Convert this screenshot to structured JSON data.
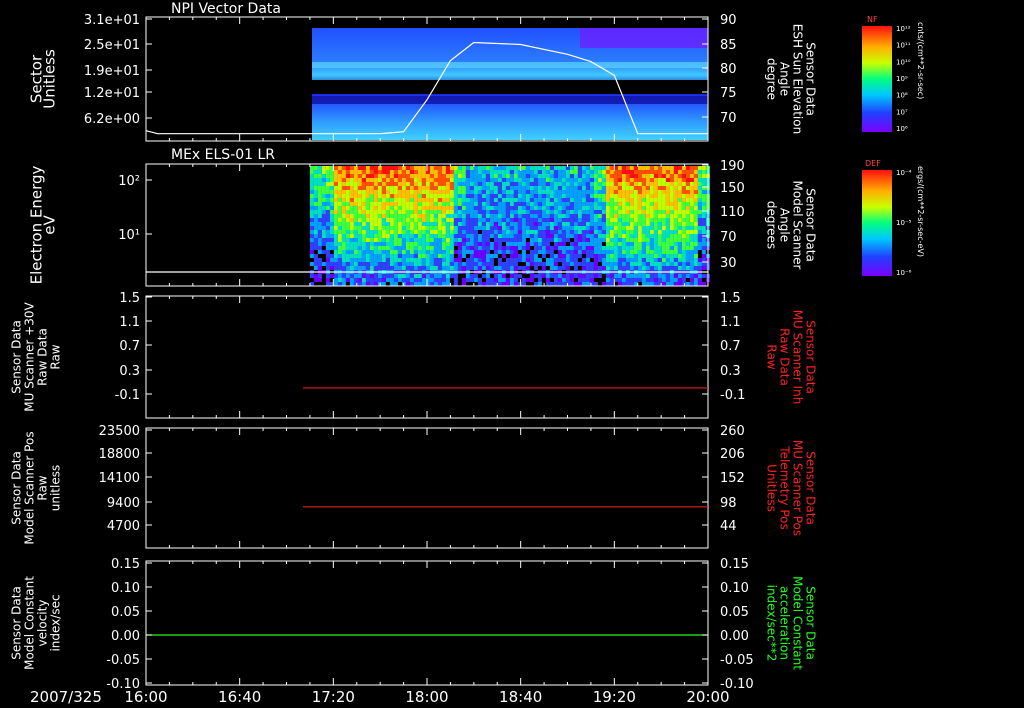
{
  "date_label": "2007/325",
  "x_ticks": [
    "16:00",
    "16:40",
    "17:20",
    "18:00",
    "18:40",
    "19:20",
    "20:00"
  ],
  "panels": [
    {
      "title": "NPI Vector Data",
      "left_label": [
        "Sector",
        "Unitless"
      ],
      "left_ticks": [
        "3.1e+01",
        "2.5e+01",
        "1.9e+01",
        "1.2e+01",
        "6.2e+00"
      ],
      "right_label": [
        "Sensor Data",
        "ESH Sun Elevation",
        "Angle",
        "degree"
      ],
      "right_ticks": [
        "90",
        "85",
        "80",
        "75",
        "70"
      ],
      "right_label_color": "#ffffff"
    },
    {
      "title": "MEx ELS-01 LR",
      "left_label": [
        "Electron Energy",
        "eV"
      ],
      "left_ticks": [
        "10²",
        "10¹"
      ],
      "right_label": [
        "Sensor Data",
        "Model Scanner",
        "Angle",
        "degrees"
      ],
      "right_ticks": [
        "190",
        "150",
        "110",
        "70",
        "30"
      ],
      "right_label_color": "#ffffff"
    },
    {
      "title": "",
      "left_label": [
        "Sensor Data",
        "MU Scanner +30V",
        "Raw Data",
        "Raw"
      ],
      "left_ticks": [
        "1.5",
        "1.1",
        "0.7",
        "0.3",
        "-0.1"
      ],
      "right_label": [
        "Sensor Data",
        "MU Scanner Inh",
        "Raw Data",
        "Raw"
      ],
      "right_ticks": [
        "1.5",
        "1.1",
        "0.7",
        "0.3",
        "-0.1"
      ],
      "right_label_color": "#ff2020"
    },
    {
      "title": "",
      "left_label": [
        "Sensor Data",
        "Model Scanner Pos",
        "Raw",
        "unitless"
      ],
      "left_ticks": [
        "23500",
        "18800",
        "14100",
        "9400",
        "4700"
      ],
      "right_label": [
        "Sensor Data",
        "MU Scanner Pos",
        "Telemetry Pos",
        "Unitless"
      ],
      "right_ticks": [
        "260",
        "206",
        "152",
        "98",
        "44"
      ],
      "right_label_color": "#ff2020"
    },
    {
      "title": "",
      "left_label": [
        "Sensor Data",
        "Model Constant",
        "velocity",
        "index/sec"
      ],
      "left_ticks": [
        "0.15",
        "0.10",
        "0.05",
        "0.00",
        "-0.05",
        "-0.10"
      ],
      "right_label": [
        "Sensor Data",
        "Model Constant",
        "acceleration",
        "index/sec**2"
      ],
      "right_ticks": [
        "0.15",
        "0.10",
        "0.05",
        "0.00",
        "-0.05",
        "-0.10"
      ],
      "right_label_color": "#20ff20"
    }
  ],
  "colorbars": [
    {
      "name": "NF",
      "units": "cnts/(cm**2-sr-sec)",
      "ticks": [
        "10¹²",
        "10¹¹",
        "10¹⁰",
        "10⁹",
        "10⁸",
        "10⁷",
        "10⁶"
      ]
    },
    {
      "name": "DEF",
      "units": "ergs/(cm**2-sr-sec-eV)",
      "ticks": [
        "10⁻⁴",
        "10⁻⁵",
        "10⁻⁶"
      ]
    }
  ],
  "chart_data": [
    {
      "type": "heatmap",
      "title": "NPI Vector Data",
      "xlabel": "",
      "ylabel": "Sector Unitless",
      "x_range": [
        "16:00",
        "20:00"
      ],
      "data_start": "17:10",
      "overlay_line": {
        "name": "ESH Sun Elevation Angle",
        "x": [
          "16:00",
          "16:05",
          "17:40",
          "17:50",
          "18:00",
          "18:10",
          "18:20",
          "18:40",
          "19:00",
          "19:10",
          "19:20",
          "19:30",
          "20:00"
        ],
        "y": [
          67.2,
          66.6,
          66.6,
          67,
          73.5,
          81.5,
          85.2,
          84.8,
          82.8,
          81.3,
          78.5,
          66.6,
          66.6
        ]
      }
    },
    {
      "type": "heatmap",
      "title": "MEx ELS-01 LR",
      "ylabel": "Electron Energy eV",
      "x_range": [
        "16:00",
        "20:00"
      ],
      "data_start": "17:10",
      "overlay_line": {
        "name": "Model Scanner Angle",
        "x": [
          "16:00",
          "20:00"
        ],
        "y": [
          10,
          10
        ]
      }
    },
    {
      "type": "line",
      "series": [
        {
          "name": "MU Scanner +30V Raw Data",
          "x": [
            "17:07",
            "20:00"
          ],
          "y": [
            0.0,
            0.0
          ]
        }
      ],
      "ylim": [
        -0.3,
        1.5
      ]
    },
    {
      "type": "line",
      "series": [
        {
          "name": "Model Scanner Pos Raw",
          "x": [
            "17:07",
            "20:00"
          ],
          "y": [
            8300,
            8300
          ]
        }
      ],
      "ylim": [
        0,
        23500
      ]
    },
    {
      "type": "line",
      "series": [
        {
          "name": "Model Constant velocity",
          "x": [
            "16:00",
            "20:00"
          ],
          "y": [
            0.0,
            0.0
          ]
        }
      ],
      "ylim": [
        -0.1,
        0.15
      ]
    }
  ]
}
